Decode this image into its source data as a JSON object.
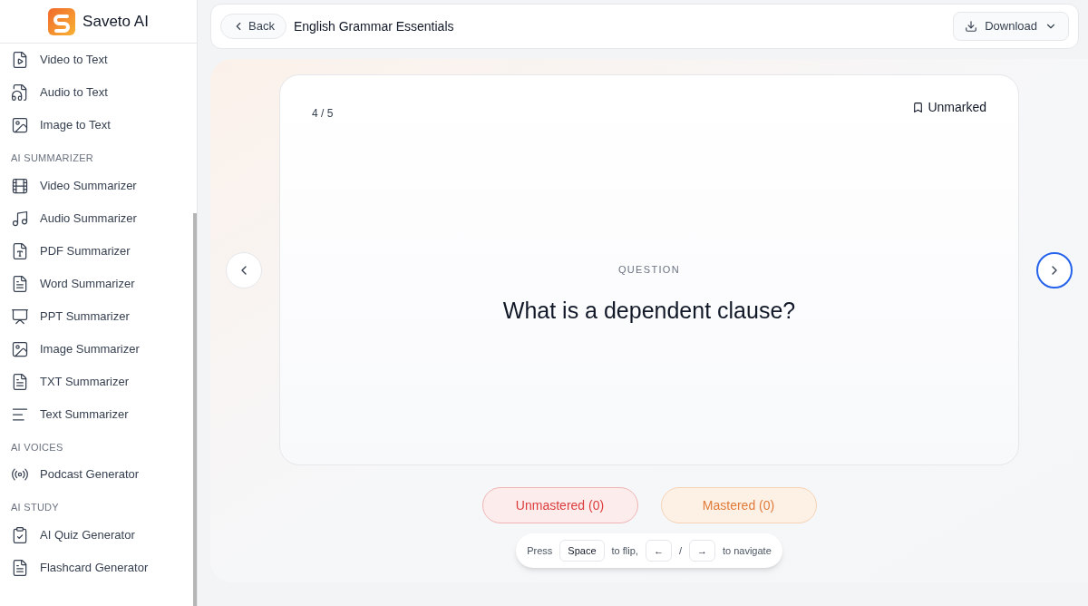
{
  "brand": {
    "name": "Saveto AI"
  },
  "sidebar": {
    "sections": [
      {
        "items": [
          {
            "label": "Video to Text",
            "kind": "file-video"
          },
          {
            "label": "Audio to Text",
            "kind": "file-audio"
          },
          {
            "label": "Image to Text",
            "kind": "image"
          }
        ]
      },
      {
        "heading": "AI SUMMARIZER",
        "items": [
          {
            "label": "Video Summarizer",
            "kind": "film"
          },
          {
            "label": "Audio Summarizer",
            "kind": "music"
          },
          {
            "label": "PDF Summarizer",
            "kind": "pdf"
          },
          {
            "label": "Word Summarizer",
            "kind": "word"
          },
          {
            "label": "PPT Summarizer",
            "kind": "ppt"
          },
          {
            "label": "Image Summarizer",
            "kind": "image"
          },
          {
            "label": "TXT Summarizer",
            "kind": "txt"
          },
          {
            "label": "Text Summarizer",
            "kind": "lines"
          }
        ]
      },
      {
        "heading": "AI VOICES",
        "items": [
          {
            "label": "Podcast Generator",
            "kind": "podcast"
          }
        ]
      },
      {
        "heading": "AI STUDY",
        "items": [
          {
            "label": "AI Quiz Generator",
            "kind": "quiz"
          },
          {
            "label": "Flashcard Generator",
            "kind": "txt"
          }
        ]
      }
    ]
  },
  "header": {
    "back": "Back",
    "title": "English Grammar Essentials",
    "download": "Download"
  },
  "card": {
    "counter": "4 / 5",
    "mark": {
      "label": "Unmarked",
      "marked": false
    },
    "side": "QUESTION",
    "text": "What is a dependent clause?"
  },
  "nav": {
    "prev": {
      "focused": false
    },
    "next": {
      "focused": true
    }
  },
  "actions": [
    {
      "label": "Unmastered (0)",
      "kind": "unmastered"
    },
    {
      "label": "Mastered (0)",
      "kind": "mastered"
    }
  ],
  "hint": [
    {
      "kind": "text",
      "text": "Press"
    },
    {
      "kind": "key",
      "text": "Space"
    },
    {
      "kind": "text",
      "text": "to flip,"
    },
    {
      "kind": "key",
      "text": "←"
    },
    {
      "kind": "text",
      "text": "/"
    },
    {
      "kind": "key",
      "text": "→"
    },
    {
      "kind": "text",
      "text": "to navigate"
    }
  ]
}
